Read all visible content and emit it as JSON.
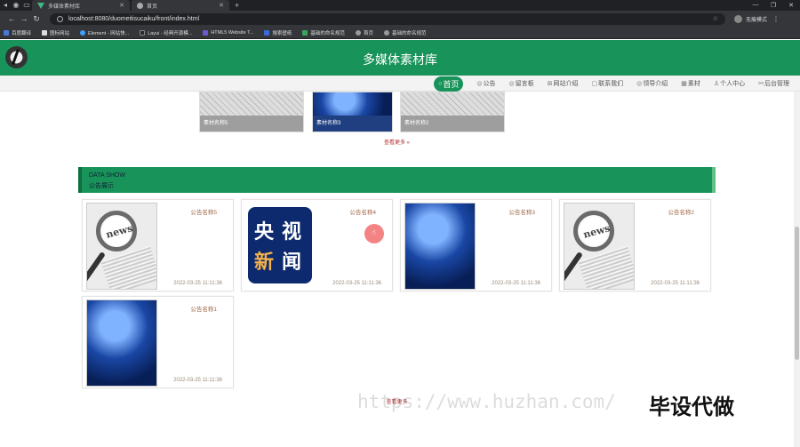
{
  "browser": {
    "tabs": [
      {
        "title": "多媒体素材库"
      },
      {
        "title": "首页"
      }
    ],
    "url": "localhost:8080/duomeitisucaiku/front/index.html",
    "profile_label": "无痕模式",
    "bookmarks": [
      "百度翻译",
      "图标网站",
      "Element - 网站快...",
      "Layui - 经典开源模...",
      "HTML5 Website T...",
      "搜索壁纸",
      "基础的命名规范",
      "首页",
      "基础的命名规范"
    ]
  },
  "header": {
    "site_title": "多媒体素材库"
  },
  "nav": {
    "items": [
      {
        "label": "首页",
        "icon": "○"
      },
      {
        "label": "公告",
        "icon": "◎"
      },
      {
        "label": "留言板",
        "icon": "◎"
      },
      {
        "label": "网站介绍",
        "icon": "⊞"
      },
      {
        "label": "联系我们",
        "icon": "▢"
      },
      {
        "label": "领导介绍",
        "icon": "◎"
      },
      {
        "label": "素材",
        "icon": "▦"
      },
      {
        "label": "个人中心",
        "icon": "♙"
      },
      {
        "label": "后台管理",
        "icon": "⚯"
      }
    ]
  },
  "materials": [
    {
      "name": "素材名称5"
    },
    {
      "name": "素材名称3"
    },
    {
      "name": "素材名称2"
    }
  ],
  "more_link": "查看更多",
  "notice_section": {
    "en": "DATA SHOW",
    "cn": "公告展示"
  },
  "notices": [
    {
      "title": "公告名称5",
      "date": "2022-03-25 11:11:36"
    },
    {
      "title": "公告名称4",
      "date": "2022-03-25 11:11:36"
    },
    {
      "title": "公告名称3",
      "date": "2022-03-25 11:11:36"
    },
    {
      "title": "公告名称2",
      "date": "2022-03-25 11:11:36"
    },
    {
      "title": "公告名称1",
      "date": "2022-03-25 11:11:36"
    }
  ],
  "cctv_text": [
    "央",
    "视",
    "新",
    "闻"
  ],
  "news_word": "news",
  "pager_text": "查看更多",
  "watermark": {
    "url": "https://www.huzhan.com/",
    "brand": "毕设代做"
  }
}
